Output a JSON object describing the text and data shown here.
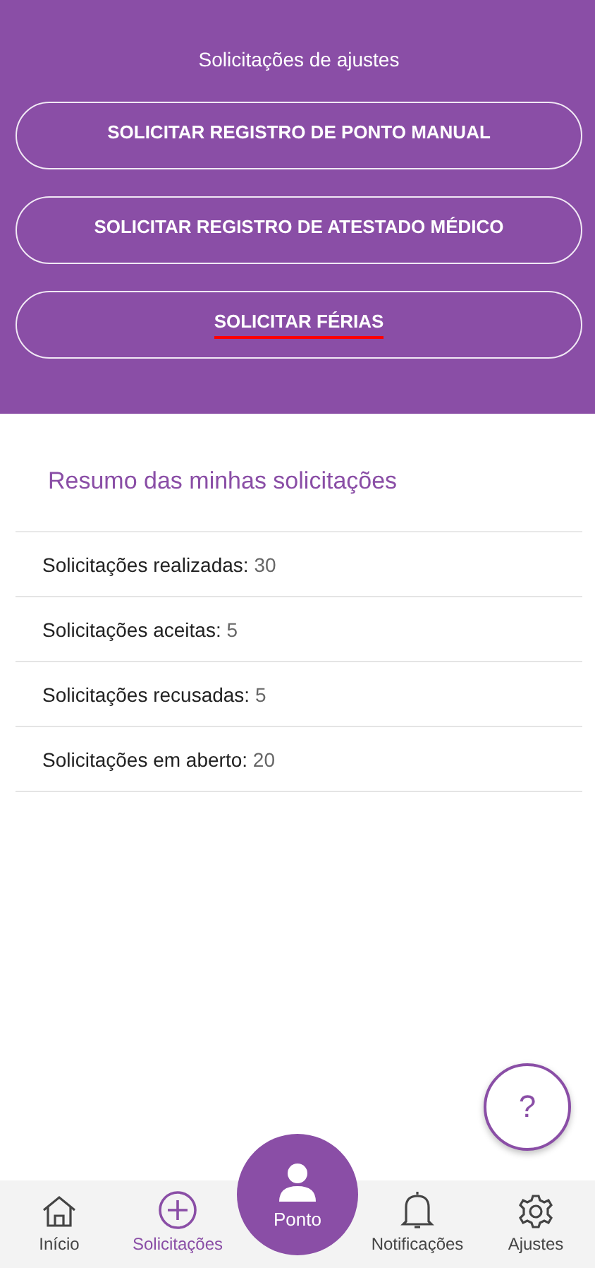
{
  "header": {
    "title": "Solicitações de ajustes"
  },
  "actions": [
    {
      "label": "SOLICITAR REGISTRO DE PONTO MANUAL",
      "underlined": false
    },
    {
      "label": "SOLICITAR REGISTRO DE ATESTADO MÉDICO",
      "underlined": false
    },
    {
      "label": "SOLICITAR FÉRIAS",
      "underlined": true
    }
  ],
  "summary": {
    "title": "Resumo das minhas solicitações",
    "rows": [
      {
        "label": "Solicitações realizadas:",
        "value": "30"
      },
      {
        "label": "Solicitações aceitas:",
        "value": "5"
      },
      {
        "label": "Solicitações recusadas:",
        "value": "5"
      },
      {
        "label": "Solicitações em aberto:",
        "value": "20"
      }
    ]
  },
  "help_button": {
    "label": "?"
  },
  "bottom_nav": [
    {
      "kind": "home",
      "label": "Início",
      "selected": false
    },
    {
      "kind": "plus",
      "label": "Solicitações",
      "selected": true
    },
    {
      "kind": "person",
      "label": "Ponto",
      "selected": false
    },
    {
      "kind": "bell",
      "label": "Notificações",
      "selected": false
    },
    {
      "kind": "gear",
      "label": "Ajustes",
      "selected": false
    }
  ]
}
